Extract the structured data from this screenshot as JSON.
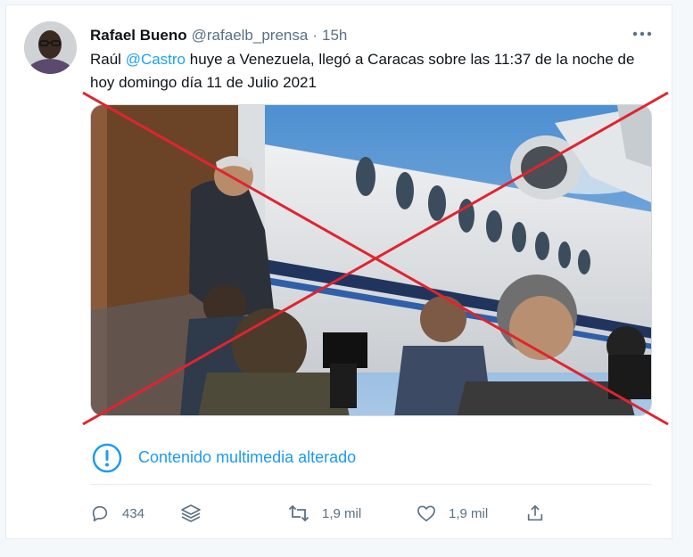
{
  "tweet": {
    "author_name": "Rafael Bueno",
    "handle": "@rafaelb_prensa",
    "separator": "·",
    "time": "15h",
    "text_before": "Raúl ",
    "mention": "@Castro",
    "text_after": " huye a Venezuela, llegó a Caracas sobre las 11:37 de la noche de hoy domingo día 11 de Julio 2021",
    "more_icon": "more-horizontal-icon"
  },
  "media": {
    "overlay_icon": "red-x-cross",
    "alt_notice_icon": "exclamation-circle-icon",
    "alt_notice_text": "Contenido multimedia alterado"
  },
  "actions": {
    "reply_count": "434",
    "retweet_count": "1,9 mil",
    "like_count": "1,9 mil"
  },
  "colors": {
    "accent": "#1da1f2",
    "secondary_text": "#5b7083",
    "overlay_red": "#e0242f"
  }
}
